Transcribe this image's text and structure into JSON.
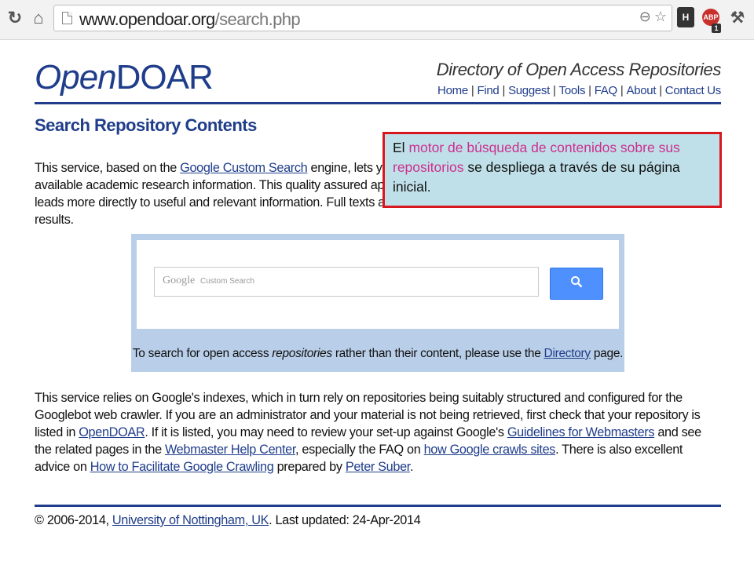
{
  "browser": {
    "url_host": "www.opendoar.org",
    "url_path": "/search.php",
    "icons": [
      "reload-icon",
      "home-icon",
      "page-icon",
      "zoom-icon",
      "star-icon",
      "h-extension-icon",
      "adblock-icon",
      "tool-icon"
    ],
    "ext_h_label": "H",
    "ext_abp_label": "ABP",
    "ext_abp_badge": "1"
  },
  "header": {
    "logo_open": "Open",
    "logo_doar": "DOAR",
    "tagline": "Directory of Open Access Repositories",
    "nav": [
      "Home",
      "Find",
      "Suggest",
      "Tools",
      "FAQ",
      "About",
      "Contact Us"
    ]
  },
  "main": {
    "title": "Search Repository Contents",
    "intro": {
      "p1": "This service, based on the ",
      "link1": "Google Custom Search",
      "p2": " engine, lets you search",
      "p3": "available academic research information. This quality assured approach",
      "p4": "leads more directly to useful and relevant information. Full texts are available for most results."
    },
    "search": {
      "brand": "Google",
      "brand_sub": "Custom Search",
      "button_icon": "search-icon",
      "note_1": "To search for open access ",
      "note_em": "repositories",
      "note_2": " rather than their content, please use the ",
      "note_link": "Directory",
      "note_3": " page."
    },
    "body": {
      "t1": "This service relies on Google's indexes, which in turn rely on repositories being suitably structured and configured for the Googlebot web crawler. If you are an administrator and your material is not being retrieved, first check that your repository is listed in ",
      "l1": "OpenDOAR",
      "t2": ". If it is listed, you may need to review your set-up against Google's ",
      "l2": "Guidelines for Webmasters",
      "t3": " and see the related pages in the ",
      "l3": "Webmaster Help Center",
      "t4": ", especially the FAQ on ",
      "l4": "how Google crawls sites",
      "t5": ". There is also excellent advice on ",
      "l5": "How to Facilitate Google Crawling",
      "t6": " prepared by ",
      "l6": "Peter Suber",
      "t7": "."
    }
  },
  "footer": {
    "copy": "© 2006-2014, ",
    "link": "University of Nottingham, UK",
    "updated": ". Last updated: 24-Apr-2014"
  },
  "callout": {
    "t1": "El ",
    "hl": "motor de búsqueda de contenidos sobre sus repositorios",
    "t2": " se despliega a través de su página inicial."
  },
  "colors": {
    "brand_blue": "#1f3d8a",
    "search_panel": "#b9cfe9",
    "search_button": "#4d90fe",
    "callout_bg": "#bfe0e8",
    "callout_border": "#d9171f",
    "callout_highlight": "#cc2f8f"
  }
}
